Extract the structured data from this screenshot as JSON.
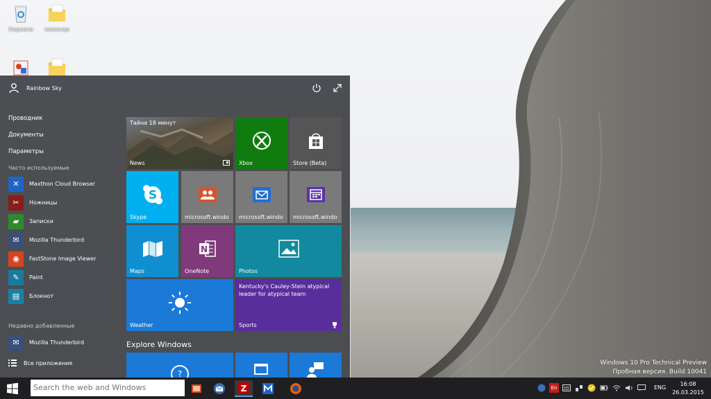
{
  "desktop": {
    "icons": [
      {
        "label": "Корзина"
      },
      {
        "label": "семинар"
      },
      {
        "label": ""
      },
      {
        "label": ""
      }
    ],
    "watermark": {
      "line1": "Windows 10 Pro Technical Preview",
      "line2": "Пробная версия. Build 10041"
    }
  },
  "start_menu": {
    "user_name": "Rainbow Sky",
    "links": [
      "Проводник",
      "Документы",
      "Параметры"
    ],
    "most_used_header": "Часто используемые",
    "most_used": [
      {
        "label": "Maxthon Cloud Browser",
        "icon": "maxthon-icon",
        "color": "#1d64c6"
      },
      {
        "label": "Ножницы",
        "icon": "scissors-icon",
        "color": "#8a1c1c"
      },
      {
        "label": "Записки",
        "icon": "sticky-notes-icon",
        "color": "#2f8a2f"
      },
      {
        "label": "Mozilla Thunderbird",
        "icon": "thunderbird-icon",
        "color": "#3a4f7a"
      },
      {
        "label": "FastStone Image Viewer",
        "icon": "faststone-icon",
        "color": "#d8431f"
      },
      {
        "label": "Paint",
        "icon": "paint-icon",
        "color": "#1a7a9e"
      },
      {
        "label": "Блокнот",
        "icon": "notepad-icon",
        "color": "#1a7fa8"
      }
    ],
    "recent_header": "Недавно добавленные",
    "recent": [
      {
        "label": "Mozilla Thunderbird",
        "icon": "thunderbird-icon",
        "color": "#3a4f7a"
      }
    ],
    "all_apps": "Все приложения",
    "tiles": {
      "news": {
        "headline": "Тайна 18 минут",
        "label": "News"
      },
      "xbox": {
        "label": "Xbox",
        "color": "#107c10"
      },
      "store": {
        "label": "Store (Beta)",
        "color": "#555555"
      },
      "skype": {
        "label": "Skype",
        "color": "#00aff0"
      },
      "people": {
        "label": "microsoft.windo",
        "color": "#7a7a7a"
      },
      "mail": {
        "label": "microsoft.windo",
        "color": "#7a7a7a"
      },
      "calendar": {
        "label": "microsoft.windo",
        "color": "#7a7a7a"
      },
      "maps": {
        "label": "Maps",
        "color": "#0f8fd1"
      },
      "onenote": {
        "label": "OneNote",
        "color": "#80397b"
      },
      "photos": {
        "label": "Photos",
        "color": "#12899e"
      },
      "weather": {
        "label": "Weather",
        "color": "#1b79d8"
      },
      "sports": {
        "headline": "Kentucky's Cauley-Stein atypical leader for atypical team",
        "label": "Sports",
        "color": "#5a2d9c"
      }
    },
    "explore_header": "Explore Windows"
  },
  "taskbar": {
    "search_placeholder": "Search the web and Windows",
    "apps": [
      {
        "name": "faststone-icon"
      },
      {
        "name": "thunderbird-icon"
      },
      {
        "name": "filezilla-icon"
      },
      {
        "name": "maxthon-icon"
      },
      {
        "name": "firefox-icon"
      }
    ],
    "language": "ENG",
    "time": "16:08",
    "date": "26.03.2015"
  }
}
